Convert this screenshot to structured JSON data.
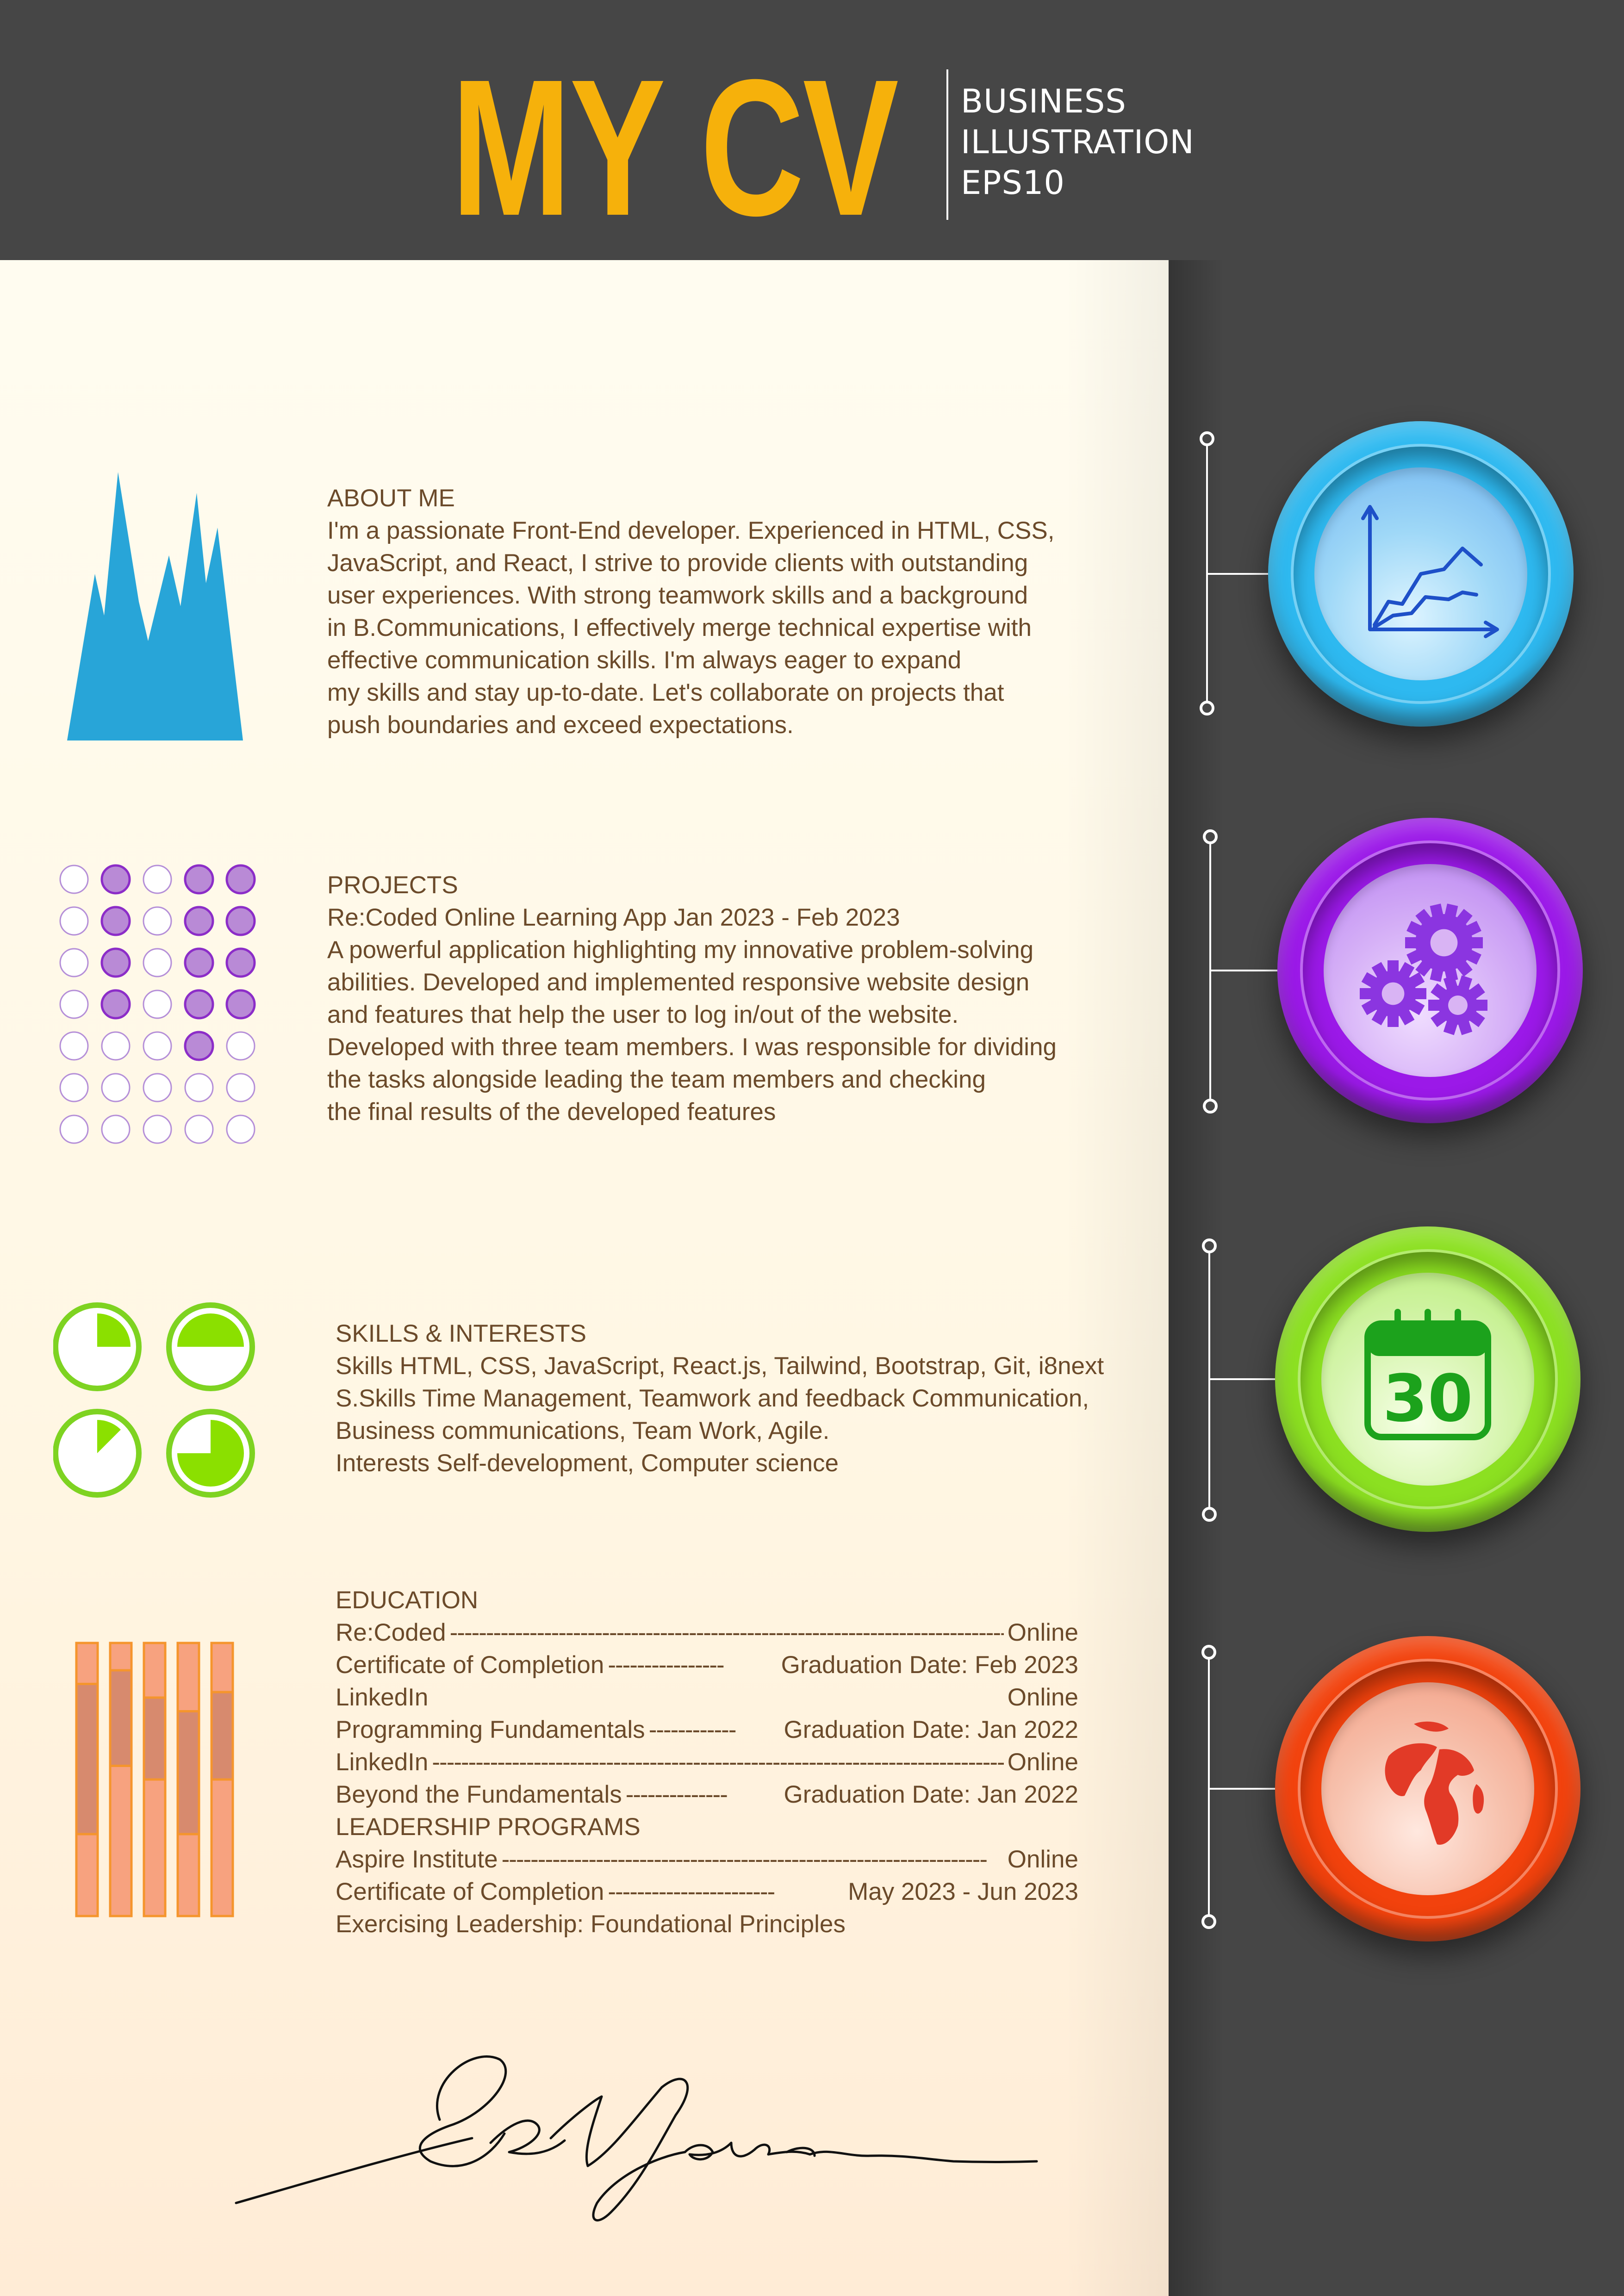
{
  "header": {
    "title": "MY CV",
    "subtitle": [
      "BUSINESS",
      "ILLUSTRATION",
      "EPS10"
    ]
  },
  "about": {
    "title": "ABOUT ME",
    "lines": [
      "I'm a passionate Front-End developer. Experienced in HTML, CSS,",
      "JavaScript, and React, I strive to provide clients with outstanding",
      "user experiences. With strong teamwork skills and a background",
      "in B.Communications, I effectively merge technical expertise with",
      "effective communication skills. I'm always eager to expand",
      "my skills and stay up-to-date. Let's collaborate on projects that",
      "push boundaries and exceed expectations."
    ]
  },
  "projects": {
    "title": "PROJECTS",
    "lines": [
      "Re:Coded Online Learning App Jan 2023 - Feb 2023",
      "A powerful application highlighting my innovative problem-solving",
      "abilities. Developed and implemented responsive website design",
      "and features that help the user to log in/out of the website.",
      "Developed with three team members. I was responsible for dividing",
      "the tasks alongside leading the team members and checking",
      "the final results of the developed features"
    ]
  },
  "skills": {
    "title": "SKILLS & INTERESTS",
    "lines": [
      "Skills HTML, CSS, JavaScript, React.js, Tailwind, Bootstrap, Git, i8next",
      "S.Skills Time Management, Teamwork and feedback Communication,",
      "Business communications, Team Work, Agile.",
      "Interests Self-development, Computer science"
    ]
  },
  "education": {
    "title": "EDUCATION",
    "rows": [
      {
        "left": "Re:Coded",
        "dashes": "-----------------------------------------------------------------------------------------------",
        "right": "Online"
      },
      {
        "left": "Certificate of Completion",
        "dashes": "----------------",
        "right": "Graduation Date: Feb 2023"
      },
      {
        "left": "LinkedIn",
        "dashes": "",
        "right": "Online"
      },
      {
        "left": "Programming Fundamentals",
        "dashes": "------------",
        "right": "Graduation Date: Jan 2022"
      },
      {
        "left": "LinkedIn",
        "dashes": "---------------------------------------------------------------------------------------",
        "right": "Online"
      },
      {
        "left": "Beyond the Fundamentals",
        "dashes": "--------------",
        "right": "Graduation Date: Jan 2022"
      }
    ],
    "leadership_title": "LEADERSHIP PROGRAMS",
    "leadership_rows": [
      {
        "left": "Aspire Institute",
        "dashes": "-------------------------------------------------------------------",
        "right": "Online"
      },
      {
        "left": "Certificate of Completion",
        "dashes": "-----------------------",
        "right": "May 2023 - Jun 2023"
      },
      {
        "left": "Exercising Leadership: Foundational Principles",
        "dashes": "",
        "right": ""
      }
    ]
  },
  "calendar": {
    "day": "30"
  },
  "circles": [
    {
      "name": "chart",
      "color": "#2EB9F0",
      "icon": "line-chart-icon"
    },
    {
      "name": "gears",
      "color": "#9B19E8",
      "icon": "gears-icon"
    },
    {
      "name": "calendar",
      "color": "#8CE021",
      "icon": "calendar-icon"
    },
    {
      "name": "globe",
      "color": "#F2420D",
      "icon": "globe-icon"
    }
  ],
  "decor": {
    "dots_filled": [
      [
        false,
        true,
        false,
        true,
        true
      ],
      [
        false,
        true,
        false,
        true,
        true
      ],
      [
        false,
        true,
        false,
        true,
        true
      ],
      [
        false,
        true,
        false,
        true,
        true
      ],
      [
        false,
        false,
        false,
        true,
        false
      ],
      [
        false,
        false,
        false,
        false,
        false
      ],
      [
        false,
        false,
        false,
        false,
        false
      ]
    ],
    "pie_fractions": [
      0.25,
      0.5,
      0.125,
      0.75
    ],
    "bar_segments": [
      [
        0.15,
        0.55,
        0.3
      ],
      [
        0.1,
        0.35,
        0.55
      ],
      [
        0.2,
        0.3,
        0.5
      ],
      [
        0.25,
        0.45,
        0.3
      ],
      [
        0.18,
        0.32,
        0.5
      ]
    ]
  },
  "signature_text": "C. R. Jordan"
}
